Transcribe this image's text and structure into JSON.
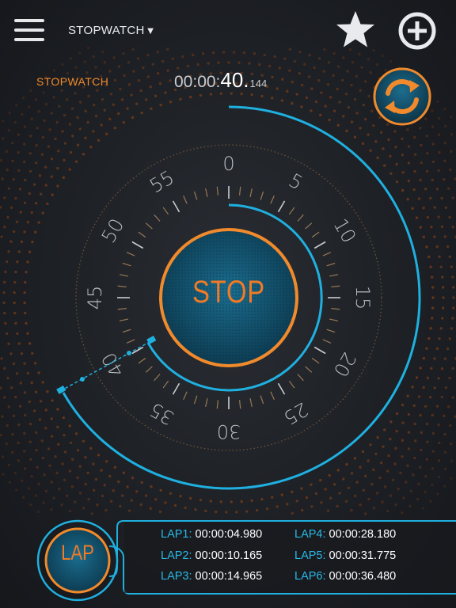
{
  "header": {
    "mode_select_label": "STOPWATCH",
    "mode_select_caret": "▼"
  },
  "display": {
    "label": "STOPWATCH",
    "time_hm": "00:00:",
    "time_sec": "40.",
    "time_ms": "144"
  },
  "dial": {
    "numbers": [
      "0",
      "5",
      "10",
      "15",
      "20",
      "25",
      "30",
      "35",
      "40",
      "45",
      "50",
      "55"
    ]
  },
  "controls": {
    "stop_label": "STOP",
    "lap_label": "LAP"
  },
  "laps": [
    {
      "name": "LAP1:",
      "time": "00:00:04.980"
    },
    {
      "name": "LAP2:",
      "time": "00:00:10.165"
    },
    {
      "name": "LAP3:",
      "time": "00:00:14.965"
    },
    {
      "name": "LAP4:",
      "time": "00:00:28.180"
    },
    {
      "name": "LAP5:",
      "time": "00:00:31.775"
    },
    {
      "name": "LAP6:",
      "time": "00:00:36.480"
    }
  ],
  "colors": {
    "accent_orange": "#f07a26",
    "accent_blue": "#1fb0e0",
    "background": "#1f2227"
  }
}
